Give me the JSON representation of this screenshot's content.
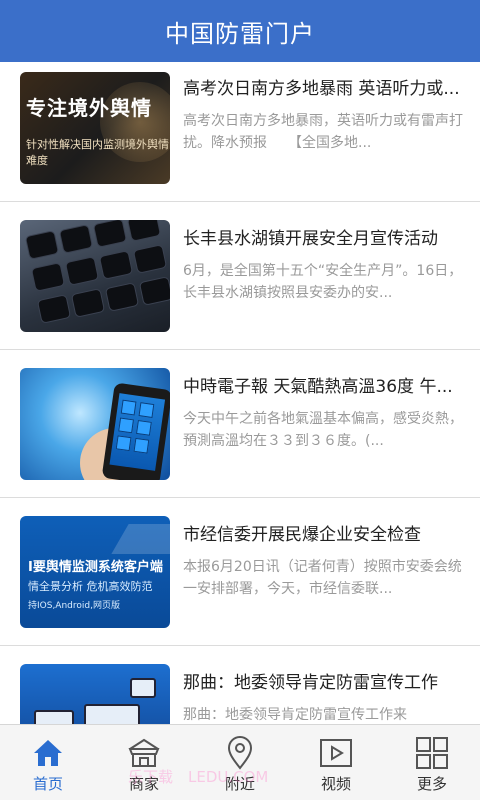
{
  "app": {
    "title": "中国防雷门户",
    "brand_color": "#3b6fc9",
    "active_color": "#2a6dd0"
  },
  "articles": [
    {
      "title": "高考次日南方多地暴雨 英语听力或...",
      "summary": "高考次日南方多地暴雨，英语听力或有雷声打扰。降水预报　　【全国多地...",
      "thumb": {
        "big_text": "专注境外舆情",
        "small_text": "针对性解决国内监测境外舆情难度"
      }
    },
    {
      "title": "长丰县水湖镇开展安全月宣传活动",
      "summary": "6月，是全国第十五个“安全生产月”。16日，长丰县水湖镇按照县安委办的安..."
    },
    {
      "title": "中時電子報 天氣酷熱高溫36度 午...",
      "summary": "今天中午之前各地氣溫基本偏高，感受炎熱，預測高溫均在３３到３６度。(..."
    },
    {
      "title": "市经信委开展民爆企业安全检查",
      "summary": "本报6月20日讯（记者何青）按照市安委会统一安排部署，今天，市经信委联...",
      "thumb": {
        "line1": "I要舆情监测系统客户端",
        "line2": "情全景分析 危机高效防范",
        "line3": "持IOS,Android,网页版"
      }
    },
    {
      "title": "那曲：地委领导肯定防雷宣传工作",
      "summary": "那曲：地委领导肯定防雷宣传工作来"
    }
  ],
  "tabs": [
    {
      "label": "首页",
      "icon": "home-icon",
      "active": true
    },
    {
      "label": "商家",
      "icon": "store-icon",
      "active": false
    },
    {
      "label": "附近",
      "icon": "location-pin-icon",
      "active": false
    },
    {
      "label": "视频",
      "icon": "video-play-icon",
      "active": false
    },
    {
      "label": "更多",
      "icon": "grid-more-icon",
      "active": false
    }
  ],
  "watermark": "乐下载　LEDU.COM"
}
